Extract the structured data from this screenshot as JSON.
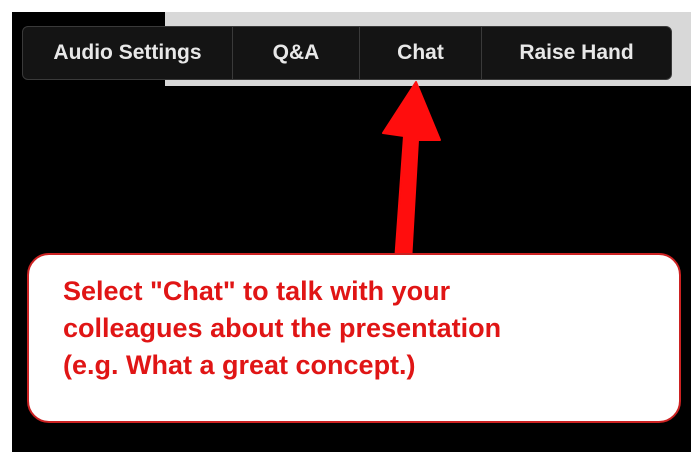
{
  "toolbar": {
    "audio_settings": "Audio Settings",
    "qa": "Q&A",
    "chat": "Chat",
    "raise_hand": "Raise Hand"
  },
  "annotation": {
    "text": "Select \"Chat\" to talk with your\ncolleagues about the presentation\n(e.g. What a great concept.)",
    "color": "#e01515"
  },
  "arrow": {
    "color": "#ff0d0d",
    "points_to": "Chat"
  }
}
